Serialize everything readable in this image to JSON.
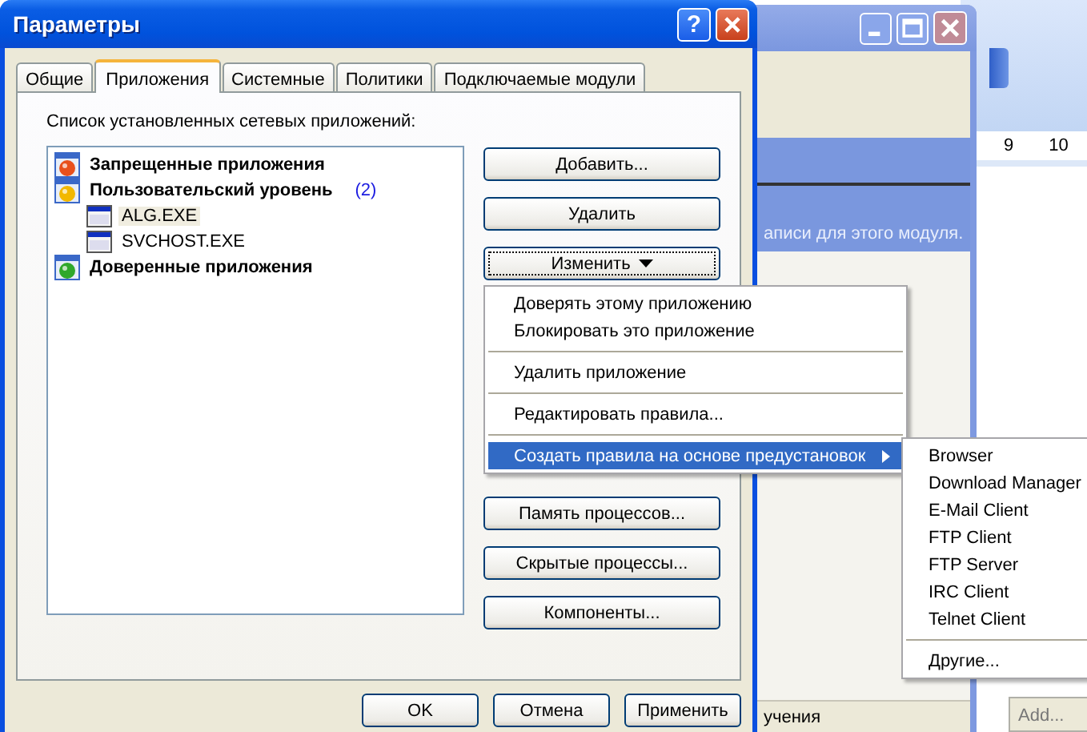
{
  "document_window": {
    "ruler_labels": [
      "9",
      "10"
    ],
    "add_button": "Add..."
  },
  "behind_window": {
    "banner_text": "аписи для этого модуля.",
    "status_text": "учения"
  },
  "dialog": {
    "title": "Параметры",
    "help_button": "?",
    "tabs": [
      {
        "label": "Общие",
        "selected": false
      },
      {
        "label": "Приложения",
        "selected": true
      },
      {
        "label": "Системные",
        "selected": false
      },
      {
        "label": "Политики",
        "selected": false
      },
      {
        "label": "Подключаемые модули",
        "selected": false
      }
    ],
    "list_label": "Список установленных сетевых приложений:",
    "tree": [
      {
        "kind": "blocked",
        "label": "Запрещенные приложения",
        "selected": false
      },
      {
        "kind": "custom",
        "label": "Пользовательский уровень",
        "count": "(2)",
        "selected": false,
        "children": [
          {
            "kind": "app",
            "label": "ALG.EXE",
            "selected": true
          },
          {
            "kind": "app",
            "label": "SVCHOST.EXE",
            "selected": false
          }
        ]
      },
      {
        "kind": "trusted",
        "label": "Доверенные приложения",
        "selected": false
      }
    ],
    "buttons_top": [
      {
        "kind": "plain",
        "label": "Добавить...",
        "focused": false
      },
      {
        "kind": "plain",
        "label": "Удалить",
        "focused": false
      },
      {
        "kind": "dropdown",
        "label": "Изменить",
        "focused": true
      }
    ],
    "buttons_bottom": [
      {
        "label": "Память процессов..."
      },
      {
        "label": "Скрытые процессы..."
      },
      {
        "label": "Компоненты..."
      }
    ],
    "footer_buttons": [
      "OK",
      "Отмена",
      "Применить"
    ]
  },
  "context_menu": {
    "items": [
      {
        "kind": "item",
        "label": "Доверять этому приложению",
        "selected": false
      },
      {
        "kind": "item",
        "label": "Блокировать это приложение",
        "selected": false
      },
      {
        "kind": "separator"
      },
      {
        "kind": "item",
        "label": "Удалить приложение",
        "selected": false
      },
      {
        "kind": "separator"
      },
      {
        "kind": "item",
        "label": "Редактировать правила...",
        "selected": false
      },
      {
        "kind": "separator"
      },
      {
        "kind": "submenu",
        "label": "Создать правила на основе предустановок",
        "selected": true
      }
    ]
  },
  "submenu": {
    "items": [
      {
        "kind": "item",
        "label": "Browser",
        "selected": false
      },
      {
        "kind": "item",
        "label": "Download Manager",
        "selected": false
      },
      {
        "kind": "item",
        "label": "E-Mail Client",
        "selected": false
      },
      {
        "kind": "item",
        "label": "FTP Client",
        "selected": false
      },
      {
        "kind": "item",
        "label": "FTP Server",
        "selected": false
      },
      {
        "kind": "item",
        "label": "IRC Client",
        "selected": false
      },
      {
        "kind": "item",
        "label": "Telnet Client",
        "selected": false
      },
      {
        "kind": "separator"
      },
      {
        "kind": "item",
        "label": "Другие...",
        "selected": false
      }
    ]
  }
}
